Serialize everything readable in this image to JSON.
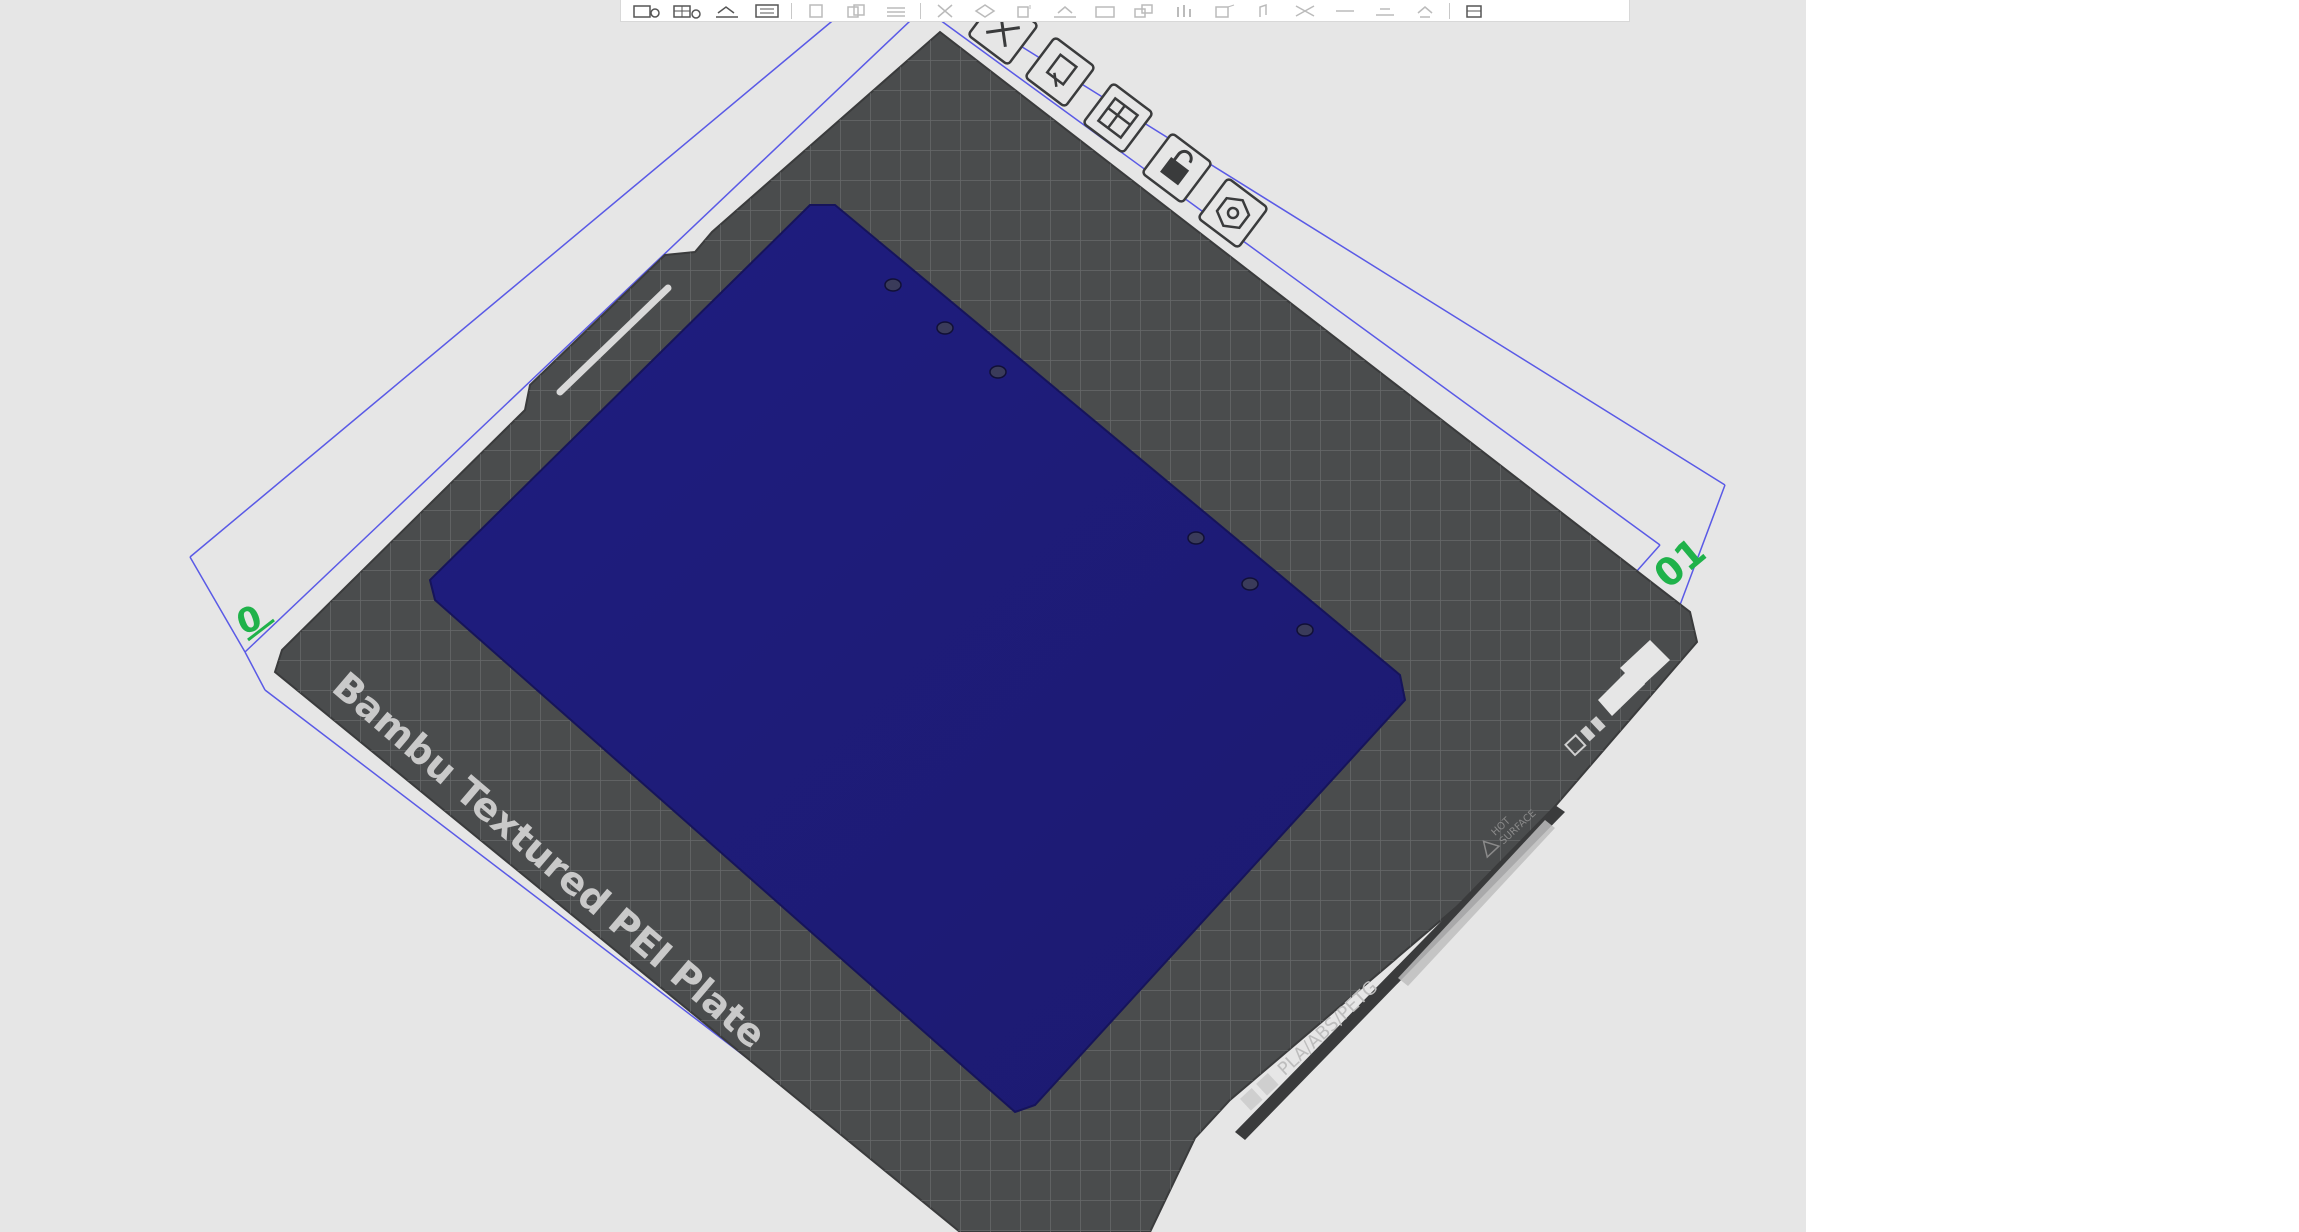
{
  "toolbar": {
    "left_tools": [
      "add-plate-icon",
      "arrange-icon",
      "orient-icon",
      "split-icon"
    ],
    "right_tools": [
      "copy-icon",
      "paste-icon",
      "layers-icon",
      "move-icon",
      "rotate-icon",
      "scale-icon",
      "lay-on-face-icon",
      "cut-icon",
      "mesh-boolean-icon",
      "support-paint-icon",
      "seam-paint-icon",
      "color-paint-icon",
      "text-icon",
      "measure-icon",
      "assembly-icon"
    ],
    "end_tool": "view-icon"
  },
  "plate": {
    "brand_label": "Bambu Textured PEI Plate",
    "material_label": "PLA/ABS/PETG",
    "hot_label_line1": "HOT",
    "hot_label_line2": "SURFACE",
    "plate_number": "01",
    "origin_axis_label": "0"
  },
  "plate_controls": [
    "close-icon",
    "pick-icon",
    "arrange-plate-icon",
    "lock-icon",
    "settings-icon"
  ],
  "colors": {
    "viewport_bg": "#e6e6e6",
    "plate_color": "#4a4c4d",
    "grid_color": "#6a6c6d",
    "model_color": "#1e1c7a",
    "bbox_color": "#5a5ae6",
    "plate_number_color": "#1fb24a",
    "label_color": "#c9c9c9"
  }
}
